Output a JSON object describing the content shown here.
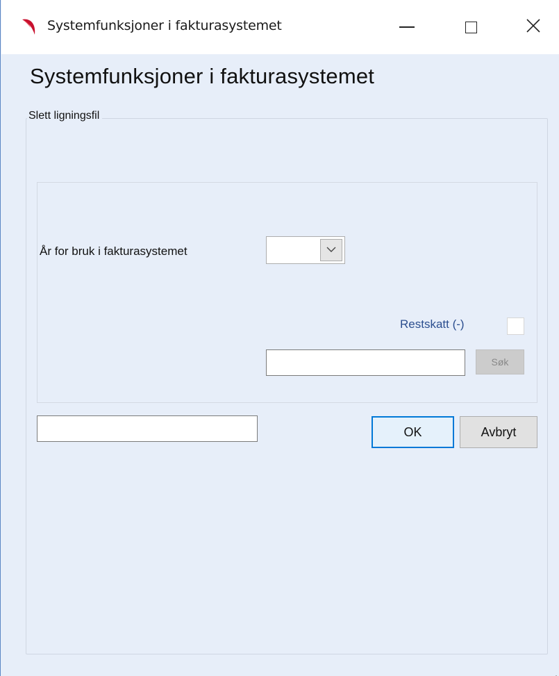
{
  "window": {
    "title": "Systemfunksjoner i fakturasystemet",
    "controls": {
      "minimize": "minimize-icon",
      "maximize": "maximize-icon",
      "close": "close-icon"
    }
  },
  "heading": "Systemfunksjoner i fakturasystemet",
  "group": {
    "legend": "Slett ligningsfil",
    "year_label": "År for bruk i fakturasystemet",
    "year_value": "",
    "restskatt_label": "Restskatt (-)",
    "restskatt_checked": false,
    "search_value": "",
    "search_button": "Søk"
  },
  "status_value": "",
  "buttons": {
    "ok": "OK",
    "cancel": "Avbryt"
  },
  "colors": {
    "background": "#e7eef9",
    "accent": "#0078d7",
    "label_blue": "#2b4e8f"
  }
}
